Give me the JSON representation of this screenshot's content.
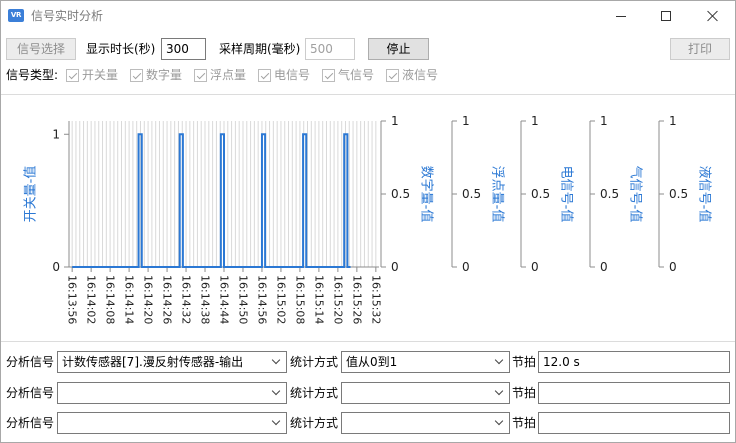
{
  "window": {
    "title": "信号实时分析",
    "logo_text": "VR",
    "icons": {
      "app": "vr-logo-icon",
      "minimize": "minimize-icon",
      "maximize": "maximize-icon",
      "close": "close-icon"
    }
  },
  "toolbar": {
    "signal_select_label": "信号选择",
    "signal_select_enabled": false,
    "duration_label": "显示时长(秒)",
    "duration_value": "300",
    "duration_enabled": true,
    "sample_label": "采样周期(毫秒)",
    "sample_value": "500",
    "sample_enabled": false,
    "stop_label": "停止",
    "stop_enabled": true,
    "print_label": "打印",
    "print_enabled": false
  },
  "signal_types": {
    "label": "信号类型:",
    "enabled": false,
    "items": [
      {
        "label": "开关量",
        "checked": true
      },
      {
        "label": "数字量",
        "checked": true
      },
      {
        "label": "浮点量",
        "checked": true
      },
      {
        "label": "电信号",
        "checked": true
      },
      {
        "label": "气信号",
        "checked": true
      },
      {
        "label": "液信号",
        "checked": true
      }
    ]
  },
  "analysis_rows": [
    {
      "signal_label": "分析信号",
      "signal_value": "计数传感器[7].漫反射传感器-输出",
      "stat_label": "统计方式",
      "stat_value": "值从0到1",
      "beat_label": "节拍",
      "beat_value": "12.0 s"
    },
    {
      "signal_label": "分析信号",
      "signal_value": "",
      "stat_label": "统计方式",
      "stat_value": "",
      "beat_label": "节拍",
      "beat_value": ""
    },
    {
      "signal_label": "分析信号",
      "signal_value": "",
      "stat_label": "统计方式",
      "stat_value": "",
      "beat_label": "节拍",
      "beat_value": ""
    }
  ],
  "colors": {
    "axis_title": "#2b78d4",
    "series": "#2b78d4",
    "grid": "#d9d9d9",
    "axis": "#8c8c8c"
  },
  "chart_data": {
    "type": "line",
    "step": "post",
    "grid": true,
    "xlim": [
      "16:13:55",
      "16:15:33"
    ],
    "x_ticks": [
      "16:13:56",
      "16:14:02",
      "16:14:08",
      "16:14:14",
      "16:14:20",
      "16:14:26",
      "16:14:32",
      "16:14:38",
      "16:14:44",
      "16:14:50",
      "16:14:56",
      "16:15:02",
      "16:15:08",
      "16:15:14",
      "16:15:20",
      "16:15:26",
      "16:15:32"
    ],
    "y_axes": [
      {
        "label": "开关量-值",
        "side": "left",
        "ylim": [
          0,
          1.1
        ],
        "ticks": [
          0,
          1
        ]
      },
      {
        "label": "数字量-值",
        "side": "right",
        "ylim": [
          0,
          1
        ],
        "ticks": [
          0,
          0.5,
          1
        ]
      },
      {
        "label": "浮点量-值",
        "side": "right",
        "ylim": [
          0,
          1
        ],
        "ticks": [
          0,
          0.5,
          1
        ]
      },
      {
        "label": "电信号-值",
        "side": "right",
        "ylim": [
          0,
          1
        ],
        "ticks": [
          0,
          0.5,
          1
        ]
      },
      {
        "label": "气信号-值",
        "side": "right",
        "ylim": [
          0,
          1
        ],
        "ticks": [
          0,
          0.5,
          1
        ]
      },
      {
        "label": "液信号-值",
        "side": "right",
        "ylim": [
          0,
          1
        ],
        "ticks": [
          0,
          0.5,
          1
        ]
      }
    ],
    "series": [
      {
        "axis": 0,
        "x": [
          "16:13:56",
          "16:14:17",
          "16:14:18",
          "16:14:30",
          "16:14:31",
          "16:14:43",
          "16:14:44",
          "16:14:56",
          "16:14:57",
          "16:15:09",
          "16:15:10",
          "16:15:22",
          "16:15:23",
          "16:15:24"
        ],
        "y": [
          0,
          1,
          0,
          1,
          0,
          1,
          0,
          1,
          0,
          1,
          0,
          1,
          0,
          0
        ]
      }
    ]
  }
}
